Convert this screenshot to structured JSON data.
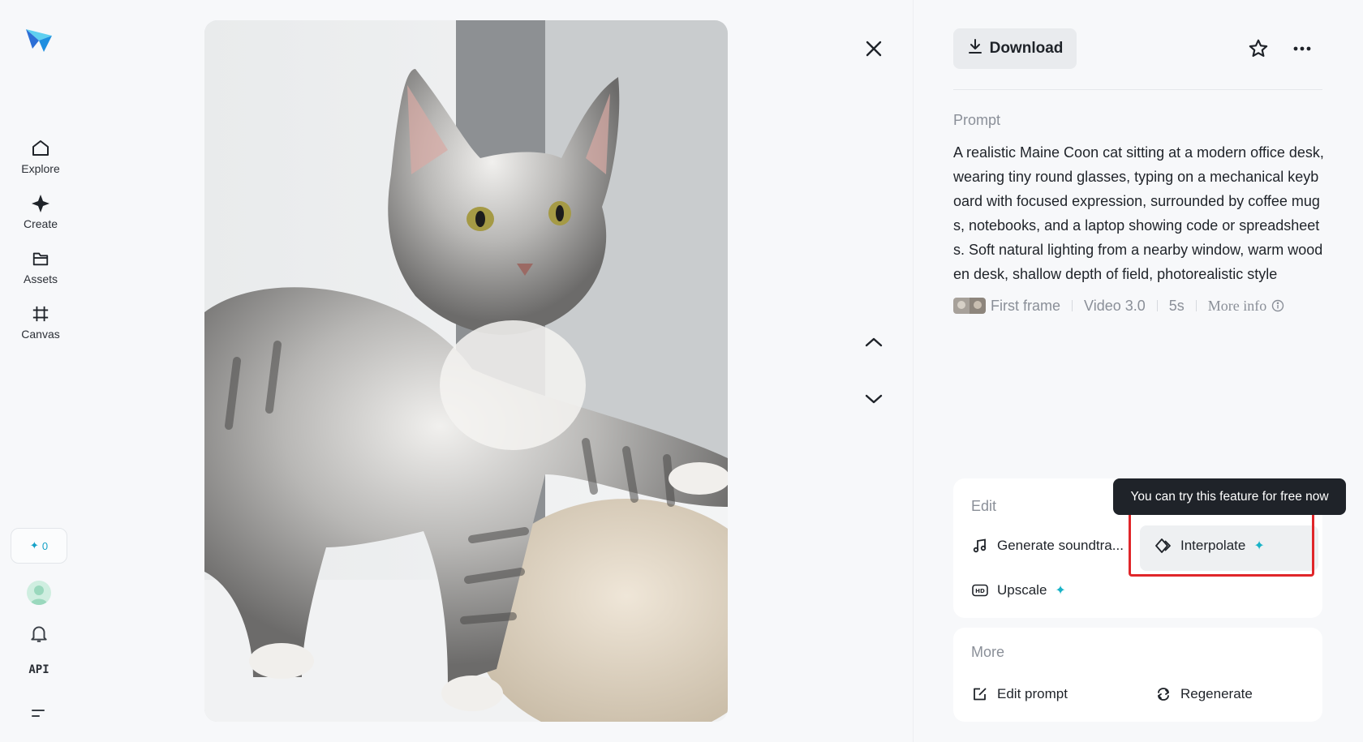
{
  "sidebar": {
    "items": [
      {
        "label": "Explore",
        "icon": "home-icon"
      },
      {
        "label": "Create",
        "icon": "sparkle-create-icon"
      },
      {
        "label": "Assets",
        "icon": "folder-icon"
      },
      {
        "label": "Canvas",
        "icon": "frame-canvas-icon"
      }
    ],
    "credits": "0",
    "api_label": "API"
  },
  "viewer": {
    "media_alt": "Maine Coon kitten standing beside a beige pouf",
    "icons": [
      "close-icon",
      "chevron-up-icon",
      "chevron-down-icon"
    ]
  },
  "panel": {
    "download_label": "Download",
    "prompt_heading": "Prompt",
    "prompt_text": "A realistic Maine Coon cat sitting at a modern office desk, wearing tiny round glasses, typing on a mechanical keyboard with focused expression, surrounded by coffee mugs, notebooks, and a laptop showing code or spreadsheets. Soft natural lighting from a nearby window, warm wooden desk, shallow depth of field, photorealistic style",
    "meta": {
      "first_frame": "First frame",
      "model": "Video 3.0",
      "duration": "5s",
      "more_info": "More info"
    },
    "edit": {
      "title": "Edit",
      "generate_soundtrack": "Generate soundtra...",
      "interpolate": "Interpolate",
      "upscale": "Upscale",
      "tooltip": "You can try this feature for free now"
    },
    "more": {
      "title": "More",
      "edit_prompt": "Edit prompt",
      "regenerate": "Regenerate"
    }
  },
  "colors": {
    "accent": "#19b3c7",
    "highlight": "#e0262a",
    "tooltip_bg": "#1f2329"
  }
}
